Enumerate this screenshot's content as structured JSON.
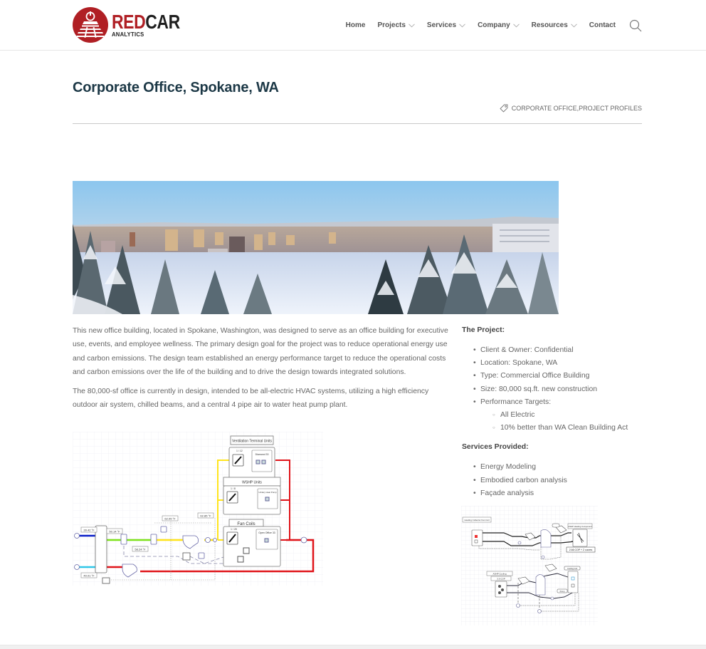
{
  "brand": {
    "name_part1": "RED",
    "name_part2": "CAR",
    "subtitle": "ANALYTICS",
    "primary_color": "#b01f24",
    "dark_color": "#1f1f1f"
  },
  "nav": {
    "items": [
      {
        "label": "Home",
        "has_dropdown": false
      },
      {
        "label": "Projects",
        "has_dropdown": true
      },
      {
        "label": "Services",
        "has_dropdown": true
      },
      {
        "label": "Company",
        "has_dropdown": true
      },
      {
        "label": "Resources",
        "has_dropdown": true
      },
      {
        "label": "Contact",
        "has_dropdown": false
      }
    ],
    "search_icon": "search-icon"
  },
  "page": {
    "title": "Corporate Office, Spokane, WA",
    "tags_icon": "tag-icon",
    "tags": [
      "CORPORATE OFFICE",
      "PROJECT PROFILES"
    ],
    "tag_separator": ", ",
    "title_color": "#1c3846"
  },
  "hero": {
    "alt": "Snowy panorama of downtown Spokane at sunrise"
  },
  "body": {
    "paragraphs": [
      "This new office building, located in Spokane, Washington, was designed to serve as an office building for executive use, events, and employee wellness. The primary design goal for the project was to reduce operational energy use and carbon emissions. The design team established an energy performance target to reduce the operational costs and carbon emissions over the life of the building and to drive the design towards integrated solutions.",
      "The 80,000-sf office is currently in design, intended to be all-electric HVAC systems, utilizing a high efficiency outdoor air system, chilled beams, and a central 4 pipe air to water heat pump plant."
    ]
  },
  "sidebar": {
    "project_heading": "The Project:",
    "project_items": [
      {
        "label": "Client & Owner: Confidential"
      },
      {
        "label": "Location: Spokane, WA"
      },
      {
        "label": "Type: Commercial Office Building"
      },
      {
        "label": "Size: 80,000 sq.ft. new construction"
      },
      {
        "label": "Performance Targets:",
        "children": [
          "All Electric",
          "10% better than WA Clean Building Act"
        ]
      }
    ],
    "services_heading": "Services Provided:",
    "services_items": [
      "Energy Modeling",
      "Embodied carbon analysis",
      "Façade analysis"
    ]
  },
  "diagram_left": {
    "boxes": {
      "ventilation": "Ventilation Terminal Units",
      "ventilation_inner": "Diamond 33",
      "wshp": "WSHP Units",
      "wshp_inner": "Unitary Heat Pump",
      "fan_coils": "Fan Coils",
      "fan_coils_inner": "Open Office 33",
      "zone_count_1": "1 / 12",
      "zone_count_2": "1 / 8",
      "zone_count_3": "1 / 28"
    },
    "temps": [
      "39.42 °F",
      "50.14 °F",
      "58.24 °F",
      "40.01 °F",
      "62.05 °F",
      "62.85 °F"
    ],
    "pipe_colors": {
      "cold": "#0a1fc8",
      "cold_light": "#2fc6e8",
      "green": "#7fe21c",
      "yellow": "#ffe41c",
      "red": "#e0141a"
    }
  },
  "diagram_right": {
    "labels": {
      "heating_coil": "Heating Collector Fan Coil",
      "ashp_heating": "ASHP Heating Component",
      "cop_heating": "2.66 COP + 2 curves",
      "ashp_cooling": "ASHP Cooling",
      "cop_cooling": "3.9 COP",
      "cooling_coil": "Cooling Coil",
      "pump1": "Pump",
      "pump2": "Pump",
      "setpoint": "Setpt"
    }
  }
}
